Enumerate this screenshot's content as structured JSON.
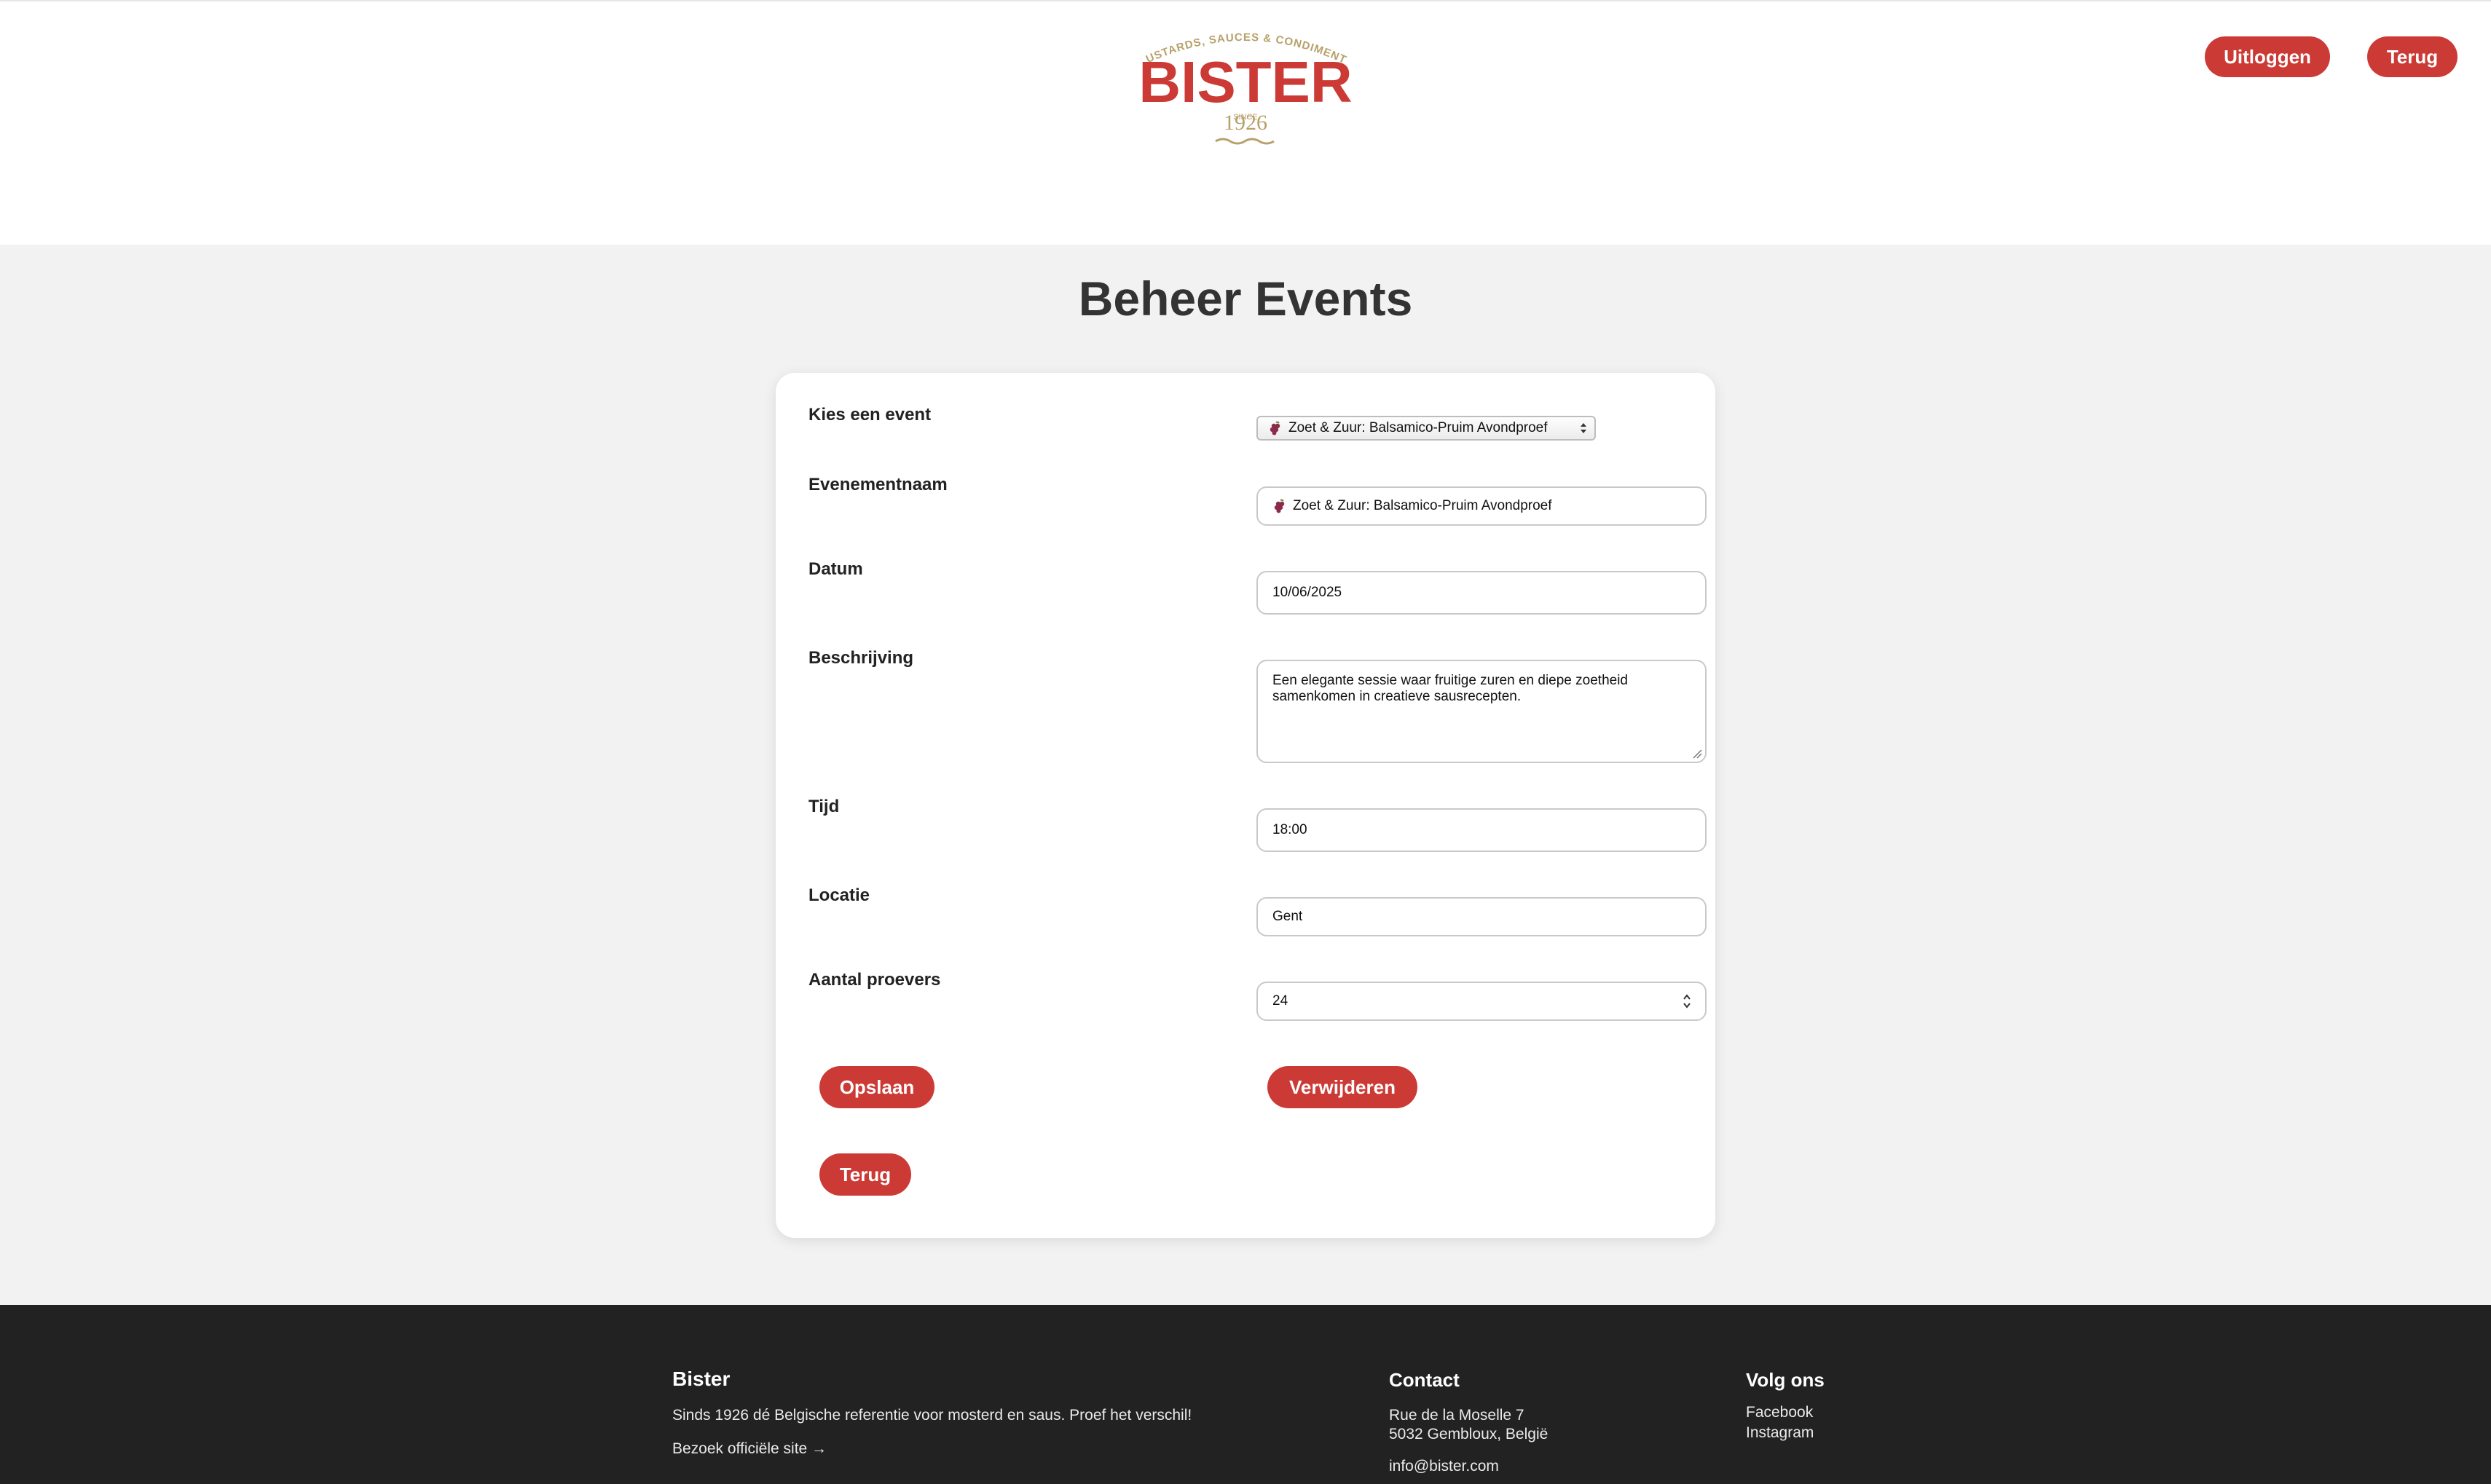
{
  "header": {
    "logo_top_text": "MUSTARDS, SAUCES & CONDIMENTS",
    "logo_brand": "BISTER",
    "logo_since": "SINCE",
    "logo_year": "1926",
    "logout_label": "Uitloggen",
    "back_label": "Terug"
  },
  "page": {
    "title": "Beheer Events"
  },
  "form": {
    "select_label": "Kies een event",
    "select_value": "Zoet & Zuur: Balsamico-Pruim Avondproef",
    "select_icon": "grapes-icon",
    "name_label": "Evenementnaam",
    "name_value": "Zoet & Zuur: Balsamico-Pruim Avondproef",
    "date_label": "Datum",
    "date_value": "10/06/2025",
    "description_label": "Beschrijving",
    "description_value": "Een elegante sessie waar fruitige zuren en diepe zoetheid samenkomen in creatieve sausrecepten.",
    "time_label": "Tijd",
    "time_value": "18:00",
    "location_label": "Locatie",
    "location_value": "Gent",
    "tasters_label": "Aantal proevers",
    "tasters_value": "24",
    "save_label": "Opslaan",
    "delete_label": "Verwijderen",
    "back_label": "Terug"
  },
  "footer": {
    "brand_title": "Bister",
    "brand_text": "Sinds 1926 dé Belgische referentie voor mosterd en saus. Proef het verschil!",
    "site_link": "Bezoek officiële site →",
    "contact_title": "Contact",
    "address_line1": "Rue de la Moselle 7",
    "address_line2": "5032 Gembloux, België",
    "email": "info@bister.com",
    "social_title": "Volg ons",
    "facebook": "Facebook",
    "instagram": "Instagram"
  },
  "colors": {
    "accent": "#cc3a35",
    "logo_gold": "#b8a06a",
    "footer_bg": "#222222",
    "page_bg": "#f2f2f2"
  }
}
